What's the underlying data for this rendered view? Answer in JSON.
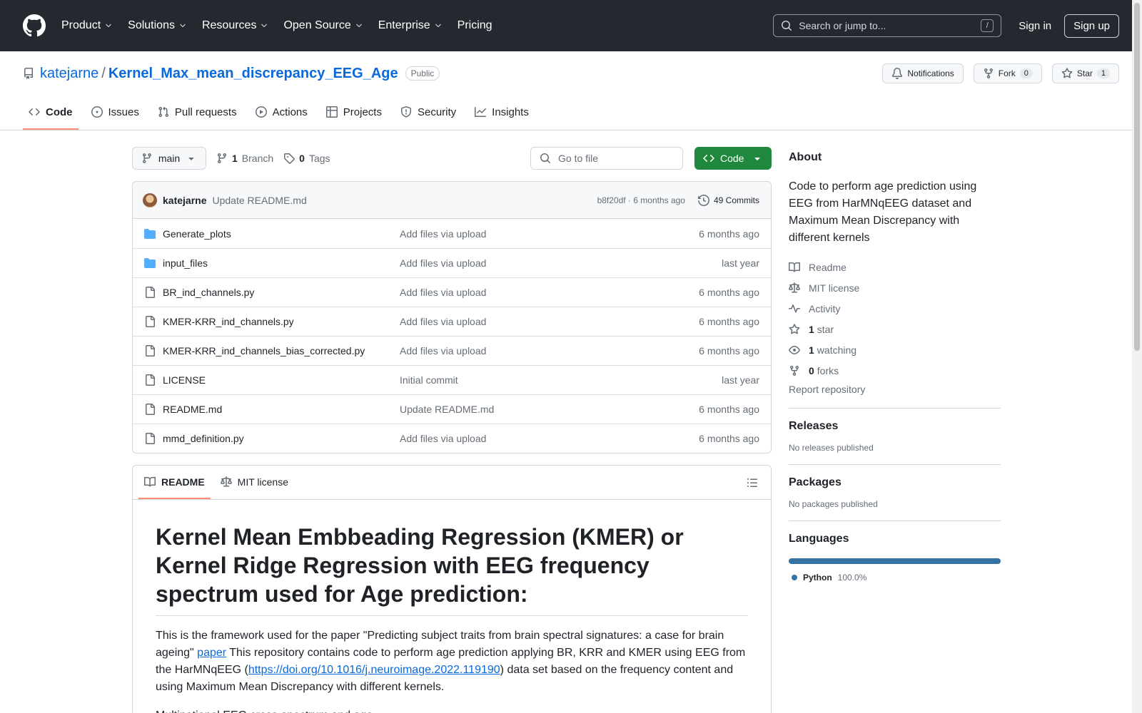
{
  "header": {
    "nav": [
      "Product",
      "Solutions",
      "Resources",
      "Open Source",
      "Enterprise",
      "Pricing"
    ],
    "search_placeholder": "Search or jump to...",
    "search_shortcut": "/",
    "signin": "Sign in",
    "signup": "Sign up"
  },
  "repo": {
    "owner": "katejarne",
    "name": "Kernel_Max_mean_discrepancy_EEG_Age",
    "visibility": "Public",
    "notifications": "Notifications",
    "fork_label": "Fork",
    "fork_count": "0",
    "star_label": "Star",
    "star_count": "1"
  },
  "tabs": [
    "Code",
    "Issues",
    "Pull requests",
    "Actions",
    "Projects",
    "Security",
    "Insights"
  ],
  "toolbar": {
    "branch": "main",
    "branch_count": "1",
    "branch_label": "Branch",
    "tag_count": "0",
    "tag_label": "Tags",
    "goto_placeholder": "Go to file",
    "code_button": "Code"
  },
  "commit": {
    "author": "katejarne",
    "message": "Update README.md",
    "hash_time": "b8f20df · 6 months ago",
    "commits": "49 Commits"
  },
  "files": [
    {
      "name": "Generate_plots",
      "type": "dir",
      "message": "Add files via upload",
      "date": "6 months ago"
    },
    {
      "name": "input_files",
      "type": "dir",
      "message": "Add files via upload",
      "date": "last year"
    },
    {
      "name": "BR_ind_channels.py",
      "type": "file",
      "message": "Add files via upload",
      "date": "6 months ago"
    },
    {
      "name": "KMER-KRR_ind_channels.py",
      "type": "file",
      "message": "Add files via upload",
      "date": "6 months ago"
    },
    {
      "name": "KMER-KRR_ind_channels_bias_corrected.py",
      "type": "file",
      "message": "Add files via upload",
      "date": "6 months ago"
    },
    {
      "name": "LICENSE",
      "type": "file",
      "message": "Initial commit",
      "date": "last year"
    },
    {
      "name": "README.md",
      "type": "file",
      "message": "Update README.md",
      "date": "6 months ago"
    },
    {
      "name": "mmd_definition.py",
      "type": "file",
      "message": "Add files via upload",
      "date": "6 months ago"
    }
  ],
  "readme": {
    "tab_readme": "README",
    "tab_license": "MIT license",
    "title": "Kernel Mean Embbeading Regression (KMER) or Kernel Ridge Regression with EEG frequency spectrum used for Age prediction:",
    "p1_a": "This is the framework used for the paper \"Predicting subject traits from brain spectral signatures: a case for brain ageing\" ",
    "p1_link": "paper",
    "p1_b": " This repository contains code to perform age prediction applying BR, KRR and KMER using EEG from the HarMNqEEG (",
    "p1_doi": "https://doi.org/10.1016/j.neuroimage.2022.119190",
    "p1_c": ") data set based on the frequency content and using Maximum Mean Discrepancy with different kernels.",
    "p2": "Multinational EEG cross-spectrum and age.."
  },
  "about": {
    "title": "About",
    "description": "Code to perform age prediction using EEG from HarMNqEEG dataset and Maximum Mean Discrepancy with different kernels",
    "readme": "Readme",
    "license": "MIT license",
    "activity": "Activity",
    "stars_num": "1",
    "stars_label": "star",
    "watching_num": "1",
    "watching_label": "watching",
    "forks_num": "0",
    "forks_label": "forks",
    "report": "Report repository"
  },
  "releases": {
    "title": "Releases",
    "text": "No releases published"
  },
  "packages": {
    "title": "Packages",
    "text": "No packages published"
  },
  "languages": {
    "title": "Languages",
    "name": "Python",
    "percent": "100.0%",
    "color": "#3572A5",
    "share": 100
  }
}
